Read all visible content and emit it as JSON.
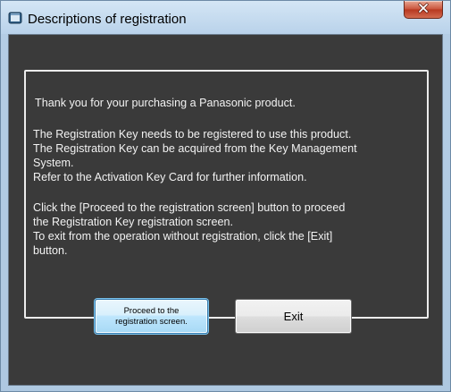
{
  "window": {
    "title": "Descriptions of registration",
    "close_label": "X"
  },
  "message": {
    "greeting": "Thank you for your purchasing a Panasonic product.",
    "para1": [
      "The Registration Key needs to be registered to use this product.",
      "The Registration Key can be acquired from the Key Management",
      "System.",
      "Refer to the Activation Key Card for further information."
    ],
    "para2": [
      "Click the [Proceed to the registration screen] button to proceed",
      "the Registration Key registration screen.",
      "To exit from the operation without registration, click the [Exit]",
      "button."
    ]
  },
  "buttons": {
    "proceed_line1": "Proceed to the",
    "proceed_line2": "registration screen.",
    "exit": "Exit"
  },
  "icons": {
    "app": "app-window-icon",
    "close": "close-icon"
  }
}
